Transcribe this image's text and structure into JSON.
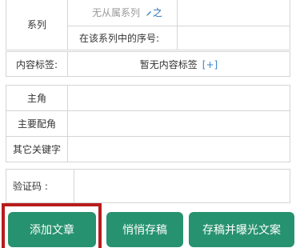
{
  "series_block": {
    "label": "系列",
    "none_text": "无从属系列",
    "link_text": "之",
    "sequence_label": "在该系列中的序号:"
  },
  "tags_block": {
    "label": "内容标签:",
    "value": "暂无内容标签",
    "add": "[+]"
  },
  "people_block": {
    "lead": "主角",
    "supporting": "主要配角",
    "keywords": "其它关键字"
  },
  "captcha_block": {
    "label": "验证码 :"
  },
  "buttons": {
    "add": "添加文章",
    "draft": "悄悄存稿",
    "publish": "存稿并曝光文案"
  },
  "colors": {
    "button_bg": "#27926f",
    "highlight": "#b71c1c",
    "link": "#3a84c6"
  }
}
